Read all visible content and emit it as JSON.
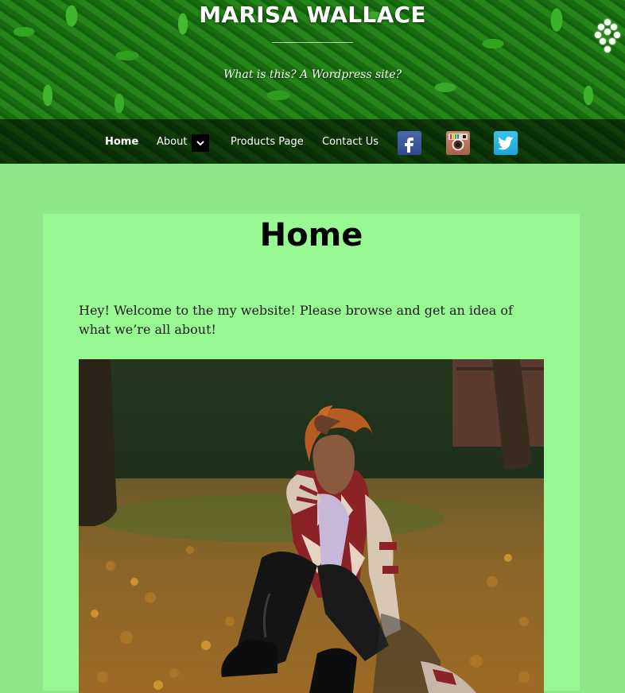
{
  "site": {
    "title": "MARISA WALLACE",
    "tagline": "What is this? A Wordpress site?"
  },
  "nav": {
    "items": [
      {
        "label": "Home",
        "active": true
      },
      {
        "label": "About",
        "has_submenu": true
      },
      {
        "label": "Products Page"
      },
      {
        "label": "Contact Us"
      }
    ],
    "social": [
      "facebook-icon",
      "instagram-icon",
      "twitter-icon"
    ]
  },
  "page": {
    "title": "Home",
    "intro": "Hey! Welcome to the my website! Please browse and get an idea of what we’re all about!"
  },
  "colors": {
    "page_bg": "#8ee88a",
    "content_bg": "#98f993",
    "nav_bg": "rgba(0,0,0,0.55)"
  }
}
